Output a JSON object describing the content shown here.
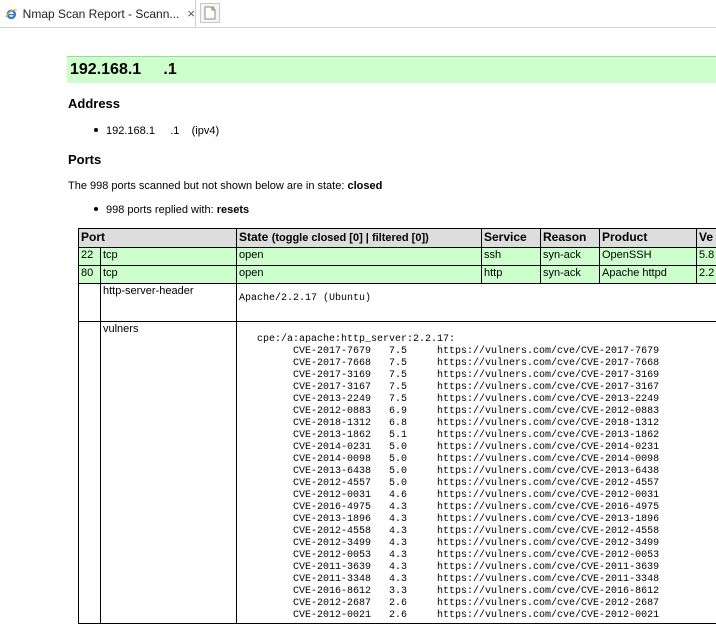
{
  "tab": {
    "title": "Nmap Scan Report - Scann...",
    "close": "×",
    "icon": "ie-icon"
  },
  "host": {
    "title": "192.168.1     .1",
    "address_heading": "Address",
    "address": "192.168.1     .1",
    "address_type": "(ipv4)"
  },
  "ports": {
    "heading": "Ports",
    "closed_text": "The 998 ports scanned but not shown below are in state:",
    "closed_state": "closed",
    "replied_text": "998 ports replied with:",
    "replied_state": "resets",
    "columns": {
      "port": "Port",
      "state": "State",
      "toggle": "(toggle closed [0] | filtered [0])",
      "service": "Service",
      "reason": "Reason",
      "product": "Product",
      "version": "Ve"
    },
    "rows": [
      {
        "port": "22",
        "proto": "tcp",
        "state": "open",
        "service": "ssh",
        "reason": "syn-ack",
        "product": "OpenSSH",
        "version": "5.8"
      },
      {
        "port": "80",
        "proto": "tcp",
        "state": "open",
        "service": "http",
        "reason": "syn-ack",
        "product": "Apache httpd",
        "version": "2.2"
      }
    ],
    "scripts": [
      {
        "id": "http-server-header",
        "output": "Apache/2.2.17 (Ubuntu)"
      },
      {
        "id": "vulners",
        "output": "  cpe:/a:apache:http_server:2.2.17: \n        CVE-2017-7679   7.5     https://vulners.com/cve/CVE-2017-7679\n        CVE-2017-7668   7.5     https://vulners.com/cve/CVE-2017-7668\n        CVE-2017-3169   7.5     https://vulners.com/cve/CVE-2017-3169\n        CVE-2017-3167   7.5     https://vulners.com/cve/CVE-2017-3167\n        CVE-2013-2249   7.5     https://vulners.com/cve/CVE-2013-2249\n        CVE-2012-0883   6.9     https://vulners.com/cve/CVE-2012-0883\n        CVE-2018-1312   6.8     https://vulners.com/cve/CVE-2018-1312\n        CVE-2013-1862   5.1     https://vulners.com/cve/CVE-2013-1862\n        CVE-2014-0231   5.0     https://vulners.com/cve/CVE-2014-0231\n        CVE-2014-0098   5.0     https://vulners.com/cve/CVE-2014-0098\n        CVE-2013-6438   5.0     https://vulners.com/cve/CVE-2013-6438\n        CVE-2012-4557   5.0     https://vulners.com/cve/CVE-2012-4557\n        CVE-2012-0031   4.6     https://vulners.com/cve/CVE-2012-0031\n        CVE-2016-4975   4.3     https://vulners.com/cve/CVE-2016-4975\n        CVE-2013-1896   4.3     https://vulners.com/cve/CVE-2013-1896\n        CVE-2012-4558   4.3     https://vulners.com/cve/CVE-2012-4558\n        CVE-2012-3499   4.3     https://vulners.com/cve/CVE-2012-3499\n        CVE-2012-0053   4.3     https://vulners.com/cve/CVE-2012-0053\n        CVE-2011-3639   4.3     https://vulners.com/cve/CVE-2011-3639\n        CVE-2011-3348   4.3     https://vulners.com/cve/CVE-2011-3348\n        CVE-2016-8612   3.3     https://vulners.com/cve/CVE-2016-8612\n        CVE-2012-2687   2.6     https://vulners.com/cve/CVE-2012-2687\n        CVE-2012-0021   2.6     https://vulners.com/cve/CVE-2012-0021"
      }
    ]
  },
  "colors": {
    "open_row": "#ccffcc",
    "header_row": "#dddddd",
    "host_header": "#ccffcc"
  }
}
